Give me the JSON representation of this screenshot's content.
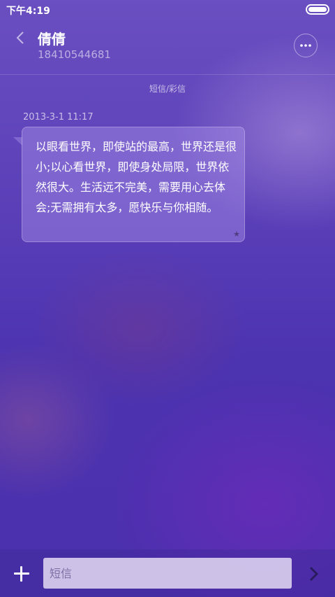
{
  "status": {
    "time": "下午4:19"
  },
  "header": {
    "name": "倩倩",
    "number": "18410544681"
  },
  "thread": {
    "type_label": "短信/彩信",
    "messages": [
      {
        "time": "2013-3-1 11:17",
        "text": "以眼看世界，即使站的最高，世界还是很小;以心看世界，即使身处局限，世界依然很大。生活远不完美，需要用心去体会;无需拥有太多，愿快乐与你相随。"
      }
    ]
  },
  "compose": {
    "placeholder": "短信"
  }
}
